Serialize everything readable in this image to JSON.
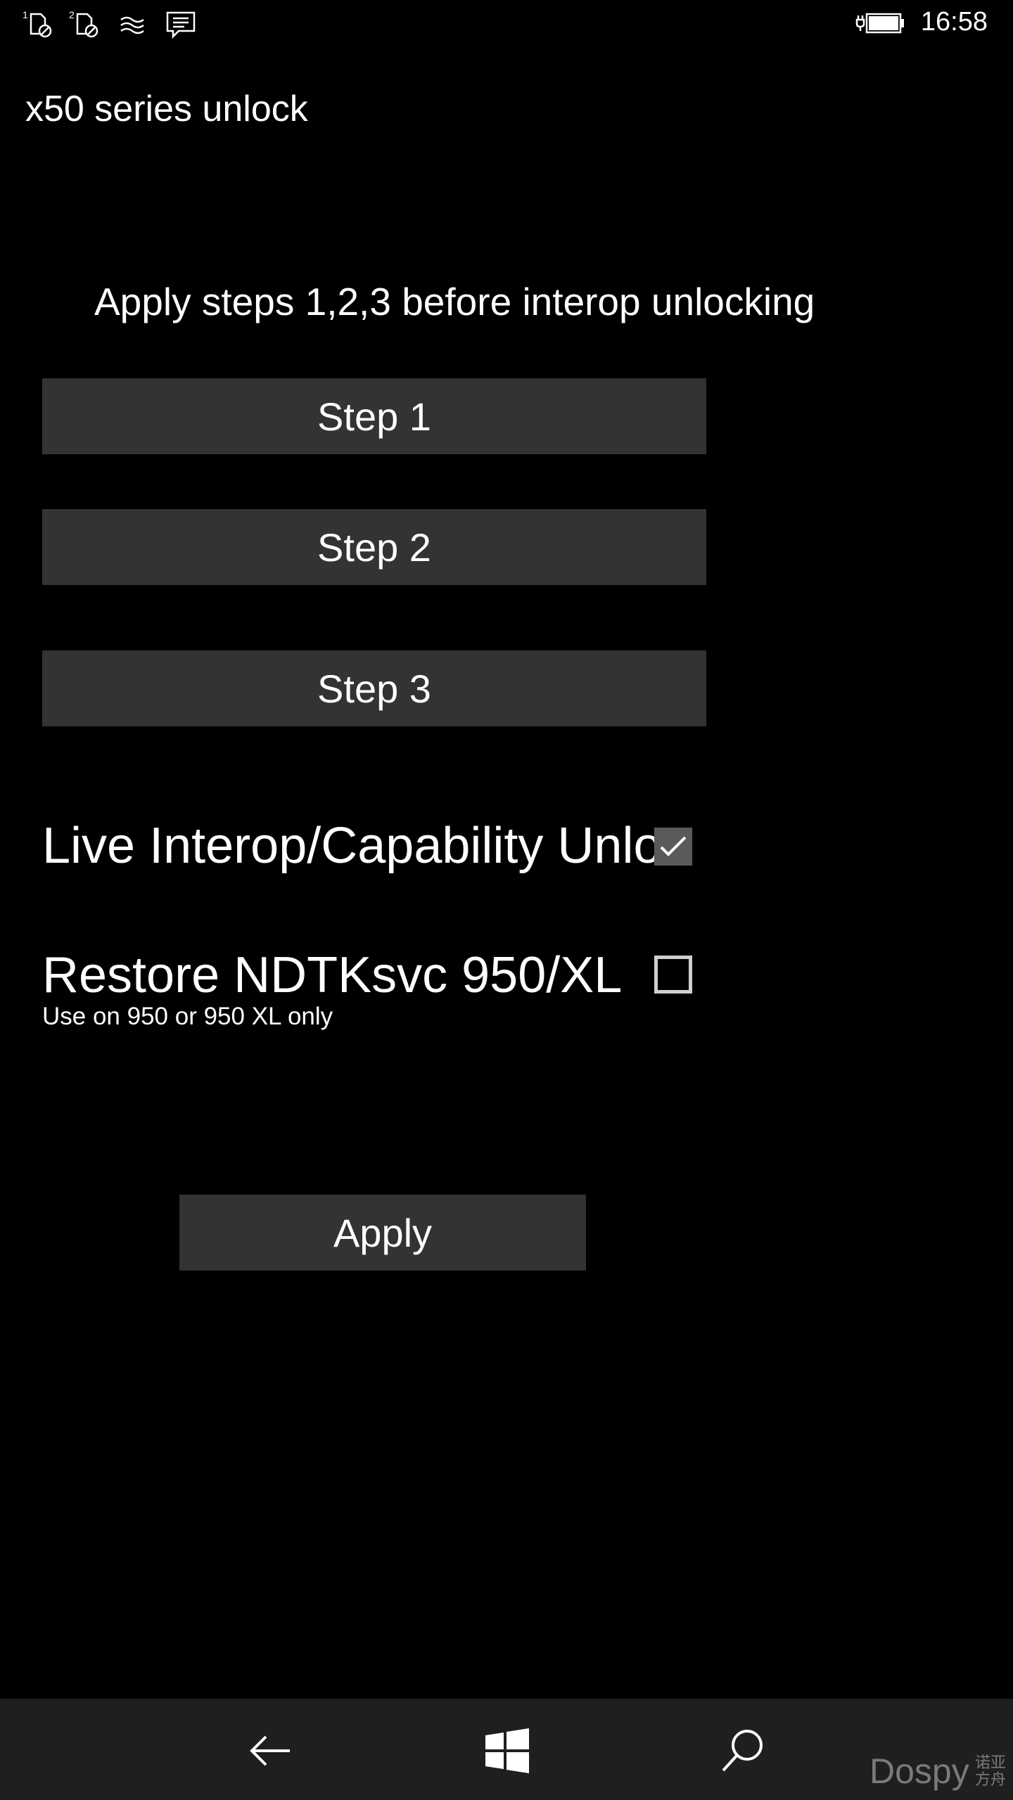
{
  "status_bar": {
    "time": "16:58",
    "sim1_label": "1",
    "sim2_label": "2",
    "icons": [
      "sim1-no-signal-icon",
      "sim2-no-signal-icon",
      "wifi-icon",
      "message-icon",
      "battery-charging-icon"
    ]
  },
  "app": {
    "title": "x50 series unlock"
  },
  "main": {
    "instruction": "Apply steps 1,2,3 before interop unlocking",
    "step_buttons": [
      {
        "label": "Step 1"
      },
      {
        "label": "Step 2"
      },
      {
        "label": "Step 3"
      }
    ],
    "options": [
      {
        "label": "Live Interop/Capability Unlock",
        "checked": true
      },
      {
        "label": "Restore NDTKsvc 950/XL",
        "subtext": "Use on 950 or 950 XL only",
        "checked": false
      }
    ],
    "apply_label": "Apply"
  },
  "nav_bar": {
    "buttons": [
      "back-icon",
      "windows-start-icon",
      "search-icon"
    ]
  },
  "watermark": {
    "text": "Dospy",
    "cn_text": "诺亚方舟"
  },
  "colors": {
    "background": "#000000",
    "button": "#333333",
    "nav_bar": "#1f1f1f",
    "text": "#ffffff"
  }
}
